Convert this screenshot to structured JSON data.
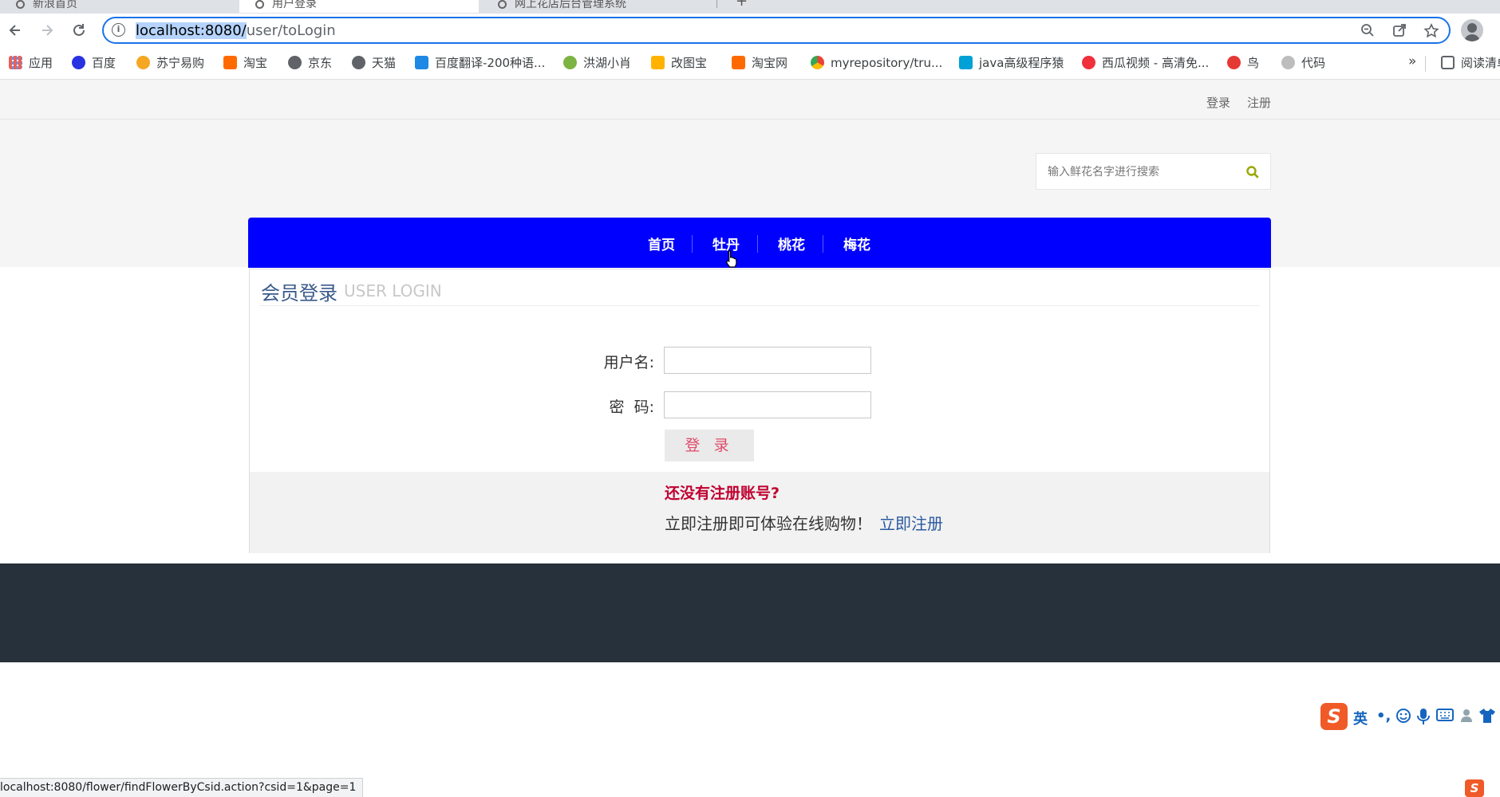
{
  "browser": {
    "tabs": [
      {
        "title": "新浪首页",
        "active": false
      },
      {
        "title": "用户登录",
        "active": true
      },
      {
        "title": "网上花店后台管理系统",
        "active": false
      }
    ],
    "url_host": "localhost:8080/",
    "url_path": "user/toLogin",
    "bookmarks": [
      {
        "label": "应用",
        "icon": "apps-grid-icon",
        "color": "#e8453c"
      },
      {
        "label": "百度",
        "icon": "baidu-paw-icon",
        "color": "#2932e1"
      },
      {
        "label": "苏宁易购",
        "icon": "suning-icon",
        "color": "#f5a623"
      },
      {
        "label": "淘宝",
        "icon": "taobao-icon",
        "color": "#ff6a00"
      },
      {
        "label": "京东",
        "icon": "globe-icon",
        "color": "#5f6368"
      },
      {
        "label": "天猫",
        "icon": "globe-icon",
        "color": "#5f6368"
      },
      {
        "label": "百度翻译-200种语...",
        "icon": "translate-icon",
        "color": "#1e88e5"
      },
      {
        "label": "洪湖小肖",
        "icon": "bird-icon",
        "color": "#7cb342"
      },
      {
        "label": "改图宝",
        "icon": "image-tool-icon",
        "color": "#ffb300"
      },
      {
        "label": "淘宝网",
        "icon": "taobao-icon",
        "color": "#ff6a00"
      },
      {
        "label": "myrepository/tru...",
        "icon": "chrome-icon",
        "color": "#34a853"
      },
      {
        "label": "java高级程序猿",
        "icon": "bilibili-icon",
        "color": "#00a1d6"
      },
      {
        "label": "西瓜视频 - 高清免...",
        "icon": "xigua-icon",
        "color": "#f0303a"
      },
      {
        "label": "鸟",
        "icon": "bird-icon",
        "color": "#e53935"
      },
      {
        "label": "代码",
        "icon": "code-icon",
        "color": "#bdbdbd"
      }
    ],
    "bookmarks_more": "»",
    "reading_list": "阅读清单",
    "status_url": "localhost:8080/flower/findFlowerByCsid.action?csid=1&page=1"
  },
  "site": {
    "top_links": {
      "login": "登录",
      "register": "注册"
    },
    "search": {
      "placeholder": "输入鲜花名字进行搜索"
    },
    "nav": [
      "首页",
      "牡丹",
      "桃花",
      "梅花"
    ],
    "nav_color": "#0000ff",
    "login": {
      "title": "会员登录",
      "subtitle": "USER LOGIN",
      "username_label": "用户名:",
      "password_label": "密  码:",
      "username_value": "",
      "password_value": "",
      "submit": "登 录",
      "no_account": "还没有注册账号?",
      "register_prompt": "立即注册即可体验在线购物！",
      "register_link": "立即注册"
    }
  },
  "ime": {
    "mode": "英",
    "punct": "•,"
  }
}
